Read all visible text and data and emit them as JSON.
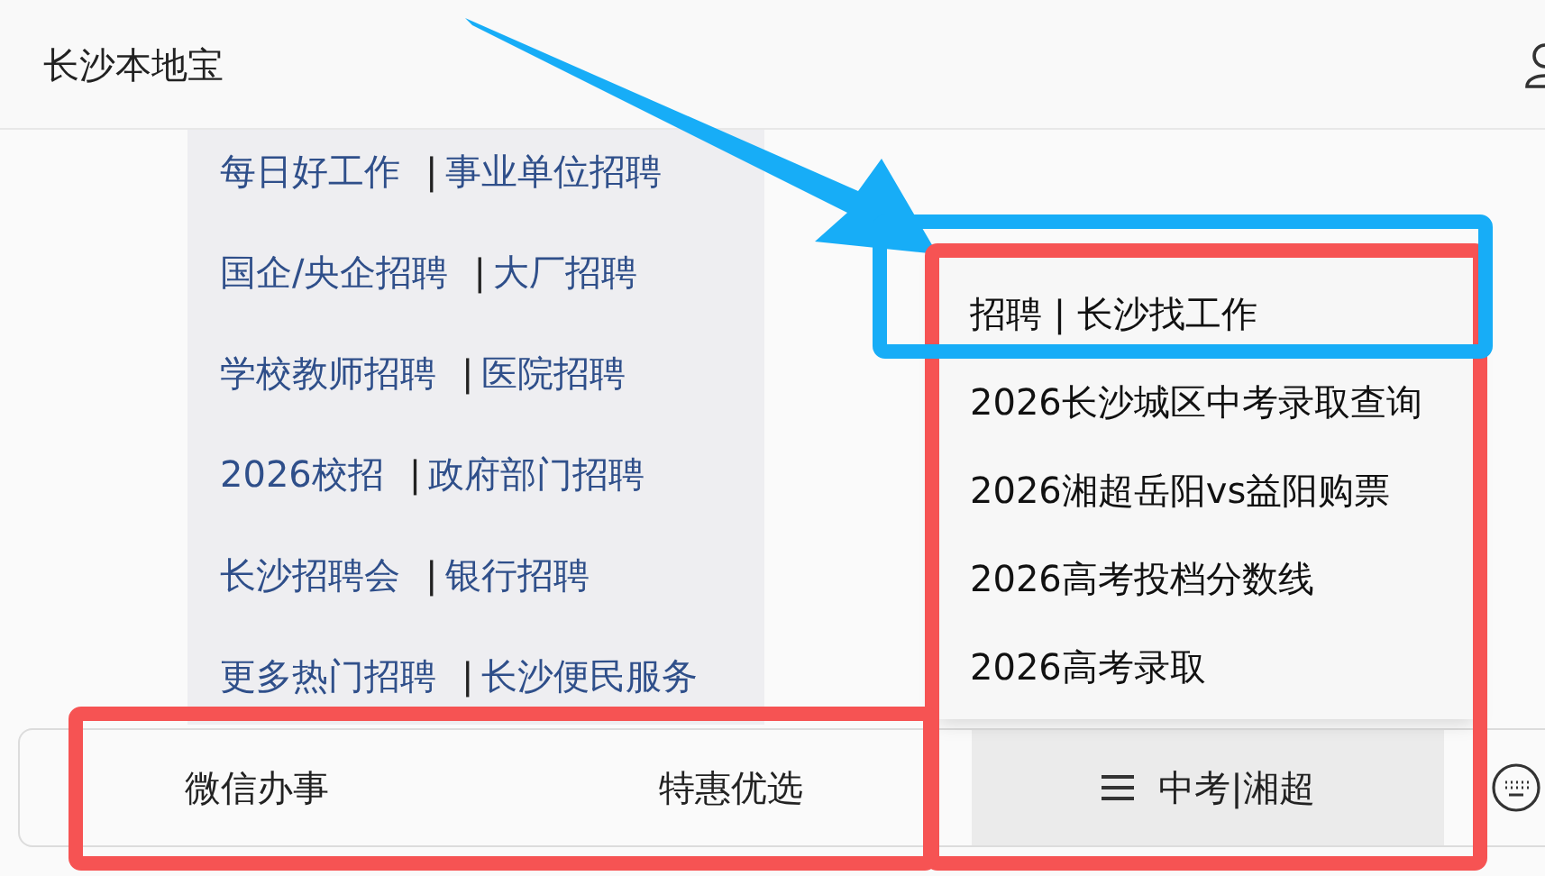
{
  "header": {
    "title": "长沙本地宝"
  },
  "links": [
    {
      "left": "每日好工作",
      "separator": "|",
      "right": "事业单位招聘"
    },
    {
      "left": "国企/央企招聘",
      "separator": "|",
      "right": "大厂招聘"
    },
    {
      "left": "学校教师招聘",
      "separator": "|",
      "right": "医院招聘"
    },
    {
      "left": "2026校招",
      "separator": "|",
      "right": "政府部门招聘"
    },
    {
      "left": "长沙招聘会",
      "separator": "|",
      "right": "银行招聘"
    },
    {
      "left": "更多热门招聘",
      "separator": "|",
      "right": "长沙便民服务"
    }
  ],
  "popup_menu": [
    "招聘 | 长沙找工作",
    "2026长沙城区中考录取查询",
    "2026湘超岳阳vs益阳购票",
    "2026高考投档分数线",
    "2026高考录取"
  ],
  "bottom_menu": [
    {
      "label": "微信办事",
      "selected": false,
      "kind": "plain"
    },
    {
      "label": "特惠优选",
      "selected": false,
      "kind": "plain"
    },
    {
      "label": "中考|湘超",
      "selected": true,
      "kind": "submenu"
    }
  ],
  "annotations": [
    {
      "kind": "arrow",
      "color": "#17adf7"
    },
    {
      "kind": "frame",
      "color": "#f65353"
    },
    {
      "kind": "frame",
      "color": "#f65353"
    },
    {
      "kind": "frame",
      "color": "#17adf7"
    }
  ]
}
